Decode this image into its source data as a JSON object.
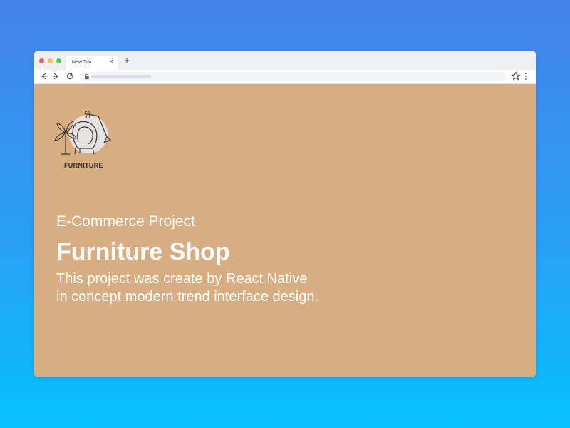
{
  "browser": {
    "tab": {
      "title": "New Tab",
      "close_icon": "close-icon"
    },
    "toolbar": {
      "new_tab_icon": "plus-icon",
      "back_icon": "back-arrow-icon",
      "forward_icon": "forward-arrow-icon",
      "reload_icon": "reload-icon",
      "lock_icon": "lock-icon",
      "bookmark_icon": "star-icon",
      "menu_icon": "kebab-menu-icon"
    }
  },
  "page": {
    "logo_text": "FURNITURE",
    "project_label": "E-Commerce Project",
    "title": "Furniture Shop",
    "description_lines": [
      "This project was create by React Native",
      "in concept modern trend interface design."
    ]
  },
  "colors": {
    "outer_background_top": "#4483E8",
    "outer_background_bottom": "#05C1FE",
    "viewport_background": "#D9AD82",
    "text_white": "#FFFFFF",
    "logo_text": "#2F2F2F"
  }
}
